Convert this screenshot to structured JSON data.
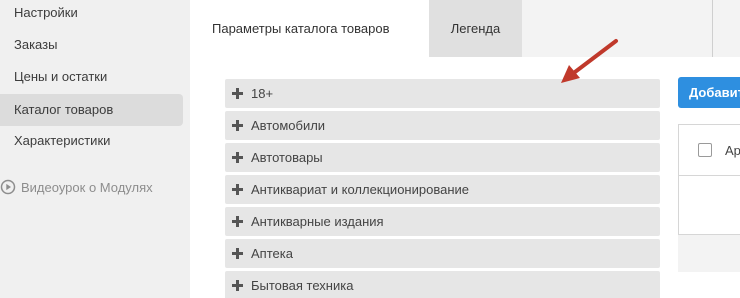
{
  "sidebar": {
    "items": [
      {
        "label": "Настройки",
        "active": false
      },
      {
        "label": "Заказы",
        "active": false
      },
      {
        "label": "Цены и остатки",
        "active": false
      },
      {
        "label": "Каталог товаров",
        "active": true
      },
      {
        "label": "Характеристики",
        "active": false
      }
    ],
    "video_link": {
      "label": "Видеоурок о Модулях",
      "icon": "play-circle-icon"
    }
  },
  "tabs": [
    {
      "label": "Параметры каталога товаров",
      "active": true
    },
    {
      "label": "Легенда",
      "active": false
    }
  ],
  "categories": [
    {
      "label": "18+",
      "icon": "plus-icon"
    },
    {
      "label": "Автомобили",
      "icon": "plus-icon"
    },
    {
      "label": "Автотовары",
      "icon": "plus-icon"
    },
    {
      "label": "Антиквариат и коллекционирование",
      "icon": "plus-icon"
    },
    {
      "label": "Антикварные издания",
      "icon": "plus-icon"
    },
    {
      "label": "Аптека",
      "icon": "plus-icon"
    },
    {
      "label": "Бытовая техника",
      "icon": "plus-icon"
    }
  ],
  "right_panel": {
    "add_button_label": "Добавит",
    "table_header_label": "Ар",
    "checkbox_checked": false
  },
  "annotation": {
    "icon": "red-arrow-icon",
    "color": "#c0392b"
  },
  "colors": {
    "sidebar_bg": "#f0f0f0",
    "active_item_bg": "#dcdcdc",
    "category_row_bg": "#e6e6e6",
    "accent_blue": "#2e8fe0",
    "arrow_red": "#c0392b"
  }
}
